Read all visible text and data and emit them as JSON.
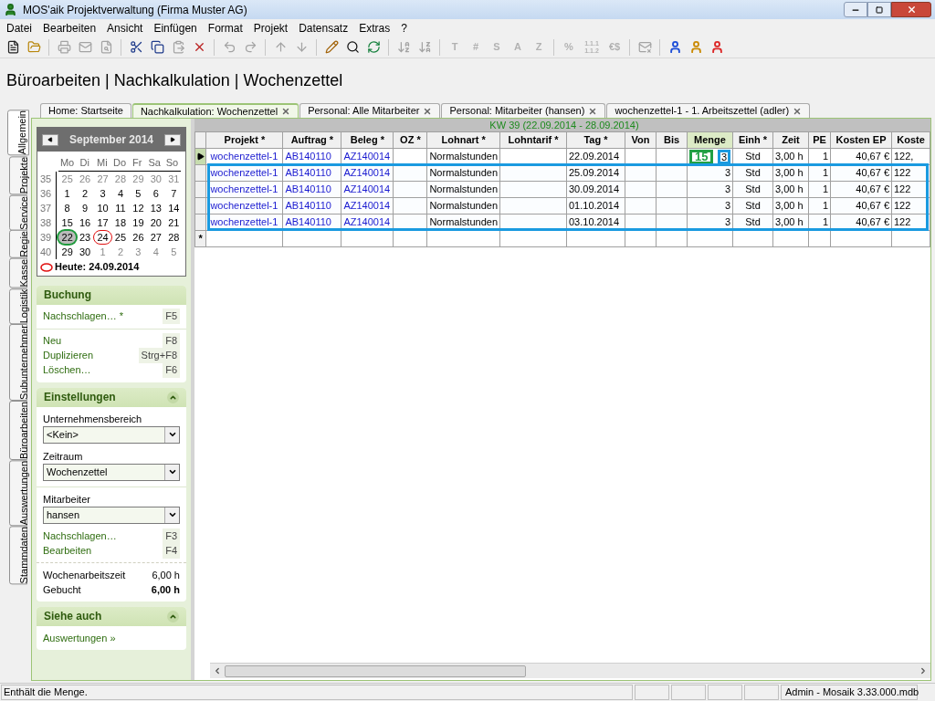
{
  "window": {
    "title": "MOS'aik Projektverwaltung (Firma Muster AG)"
  },
  "menu": [
    "Datei",
    "Bearbeiten",
    "Ansicht",
    "Einfügen",
    "Format",
    "Projekt",
    "Datensatz",
    "Extras",
    "?"
  ],
  "toolbar": [
    {
      "kind": "icon",
      "disabled": false
    },
    {
      "kind": "icon",
      "disabled": false
    },
    {
      "kind": "sep"
    },
    {
      "kind": "icon",
      "disabled": true
    },
    {
      "kind": "icon",
      "disabled": true
    },
    {
      "kind": "icon",
      "disabled": true
    },
    {
      "kind": "sep"
    },
    {
      "kind": "icon",
      "disabled": false
    },
    {
      "kind": "icon",
      "disabled": false
    },
    {
      "kind": "icon",
      "disabled": true
    },
    {
      "kind": "icon",
      "disabled": false
    },
    {
      "kind": "sep"
    },
    {
      "kind": "icon",
      "disabled": true
    },
    {
      "kind": "icon",
      "disabled": true
    },
    {
      "kind": "sep"
    },
    {
      "kind": "icon",
      "disabled": true
    },
    {
      "kind": "icon",
      "disabled": true
    },
    {
      "kind": "sep"
    },
    {
      "kind": "icon",
      "disabled": false
    },
    {
      "kind": "icon",
      "disabled": false
    },
    {
      "kind": "icon",
      "disabled": false
    },
    {
      "kind": "sep"
    },
    {
      "kind": "icon",
      "disabled": true
    },
    {
      "kind": "icon",
      "disabled": true
    },
    {
      "kind": "sep"
    },
    {
      "kind": "glyph",
      "text": "T",
      "disabled": true
    },
    {
      "kind": "glyph",
      "text": "#",
      "disabled": true
    },
    {
      "kind": "glyph",
      "text": "S",
      "disabled": true
    },
    {
      "kind": "glyph",
      "text": "A",
      "disabled": true
    },
    {
      "kind": "glyph",
      "text": "Z",
      "disabled": true
    },
    {
      "kind": "sep"
    },
    {
      "kind": "glyph",
      "text": "%",
      "disabled": true
    },
    {
      "kind": "glyph",
      "text": "1.1.1 1.1.2",
      "disabled": true
    },
    {
      "kind": "glyph",
      "text": "€$",
      "disabled": true
    },
    {
      "kind": "sep"
    },
    {
      "kind": "icon",
      "disabled": true
    },
    {
      "kind": "sep"
    },
    {
      "kind": "icon",
      "disabled": false
    },
    {
      "kind": "icon",
      "disabled": false
    },
    {
      "kind": "icon",
      "disabled": false
    }
  ],
  "page_title": "Büroarbeiten | Nachkalkulation | Wochenzettel",
  "side_tabs": [
    {
      "label": "Allgemein",
      "selected": true
    },
    {
      "label": "Projekte",
      "selected": false
    },
    {
      "label": "Service",
      "selected": false
    },
    {
      "label": "Regie",
      "selected": false
    },
    {
      "label": "Kasse",
      "selected": false
    },
    {
      "label": "Logistik",
      "selected": false
    },
    {
      "label": "Subunternehmer",
      "selected": false
    },
    {
      "label": "Büroarbeiten",
      "selected": false
    },
    {
      "label": "Auswertungen",
      "selected": false
    },
    {
      "label": "Stammdaten",
      "selected": false
    }
  ],
  "doc_tabs": [
    {
      "label": "Home: Startseite",
      "selected": false,
      "closable": false
    },
    {
      "label": "Nachkalkulation: Wochenzettel",
      "selected": true,
      "closable": true
    },
    {
      "label": "Personal: Alle Mitarbeiter",
      "selected": false,
      "closable": true
    },
    {
      "label": "Personal: Mitarbeiter (hansen)",
      "selected": false,
      "closable": true
    },
    {
      "label": "wochenzettel-1 - 1. Arbeitszettel (adler)",
      "selected": false,
      "closable": true
    }
  ],
  "calendar": {
    "month": "September 2014",
    "weekdays": [
      "Mo",
      "Di",
      "Mi",
      "Do",
      "Fr",
      "Sa",
      "So"
    ],
    "weeks": [
      {
        "week": "35",
        "days": [
          {
            "day": "25",
            "muted": true,
            "selected": false,
            "today": false
          },
          {
            "day": "26",
            "muted": true,
            "selected": false,
            "today": false
          },
          {
            "day": "27",
            "muted": true,
            "selected": false,
            "today": false
          },
          {
            "day": "28",
            "muted": true,
            "selected": false,
            "today": false
          },
          {
            "day": "29",
            "muted": true,
            "selected": false,
            "today": false
          },
          {
            "day": "30",
            "muted": true,
            "selected": false,
            "today": false
          },
          {
            "day": "31",
            "muted": true,
            "selected": false,
            "today": false
          }
        ]
      },
      {
        "week": "36",
        "days": [
          {
            "day": "1",
            "muted": false,
            "selected": false,
            "today": false
          },
          {
            "day": "2",
            "muted": false,
            "selected": false,
            "today": false
          },
          {
            "day": "3",
            "muted": false,
            "selected": false,
            "today": false
          },
          {
            "day": "4",
            "muted": false,
            "selected": false,
            "today": false
          },
          {
            "day": "5",
            "muted": false,
            "selected": false,
            "today": false
          },
          {
            "day": "6",
            "muted": false,
            "selected": false,
            "today": false
          },
          {
            "day": "7",
            "muted": false,
            "selected": false,
            "today": false
          }
        ]
      },
      {
        "week": "37",
        "days": [
          {
            "day": "8",
            "muted": false,
            "selected": false,
            "today": false
          },
          {
            "day": "9",
            "muted": false,
            "selected": false,
            "today": false
          },
          {
            "day": "10",
            "muted": false,
            "selected": false,
            "today": false
          },
          {
            "day": "11",
            "muted": false,
            "selected": false,
            "today": false
          },
          {
            "day": "12",
            "muted": false,
            "selected": false,
            "today": false
          },
          {
            "day": "13",
            "muted": false,
            "selected": false,
            "today": false
          },
          {
            "day": "14",
            "muted": false,
            "selected": false,
            "today": false
          }
        ]
      },
      {
        "week": "38",
        "days": [
          {
            "day": "15",
            "muted": false,
            "selected": false,
            "today": false
          },
          {
            "day": "16",
            "muted": false,
            "selected": false,
            "today": false
          },
          {
            "day": "17",
            "muted": false,
            "selected": false,
            "today": false
          },
          {
            "day": "18",
            "muted": false,
            "selected": false,
            "today": false
          },
          {
            "day": "19",
            "muted": false,
            "selected": false,
            "today": false
          },
          {
            "day": "20",
            "muted": false,
            "selected": false,
            "today": false
          },
          {
            "day": "21",
            "muted": false,
            "selected": false,
            "today": false
          }
        ]
      },
      {
        "week": "39",
        "days": [
          {
            "day": "22",
            "muted": false,
            "selected": true,
            "today": false
          },
          {
            "day": "23",
            "muted": false,
            "selected": false,
            "today": false
          },
          {
            "day": "24",
            "muted": false,
            "selected": false,
            "today": true
          },
          {
            "day": "25",
            "muted": false,
            "selected": false,
            "today": false
          },
          {
            "day": "26",
            "muted": false,
            "selected": false,
            "today": false
          },
          {
            "day": "27",
            "muted": false,
            "selected": false,
            "today": false
          },
          {
            "day": "28",
            "muted": false,
            "selected": false,
            "today": false
          }
        ]
      },
      {
        "week": "40",
        "days": [
          {
            "day": "29",
            "muted": false,
            "selected": false,
            "today": false
          },
          {
            "day": "30",
            "muted": false,
            "selected": false,
            "today": false
          },
          {
            "day": "1",
            "muted": true,
            "selected": false,
            "today": false
          },
          {
            "day": "2",
            "muted": true,
            "selected": false,
            "today": false
          },
          {
            "day": "3",
            "muted": true,
            "selected": false,
            "today": false
          },
          {
            "day": "4",
            "muted": true,
            "selected": false,
            "today": false
          },
          {
            "day": "5",
            "muted": true,
            "selected": false,
            "today": false
          }
        ]
      }
    ],
    "today_label": "Heute: 24.09.2014"
  },
  "buchung": {
    "title": "Buchung",
    "groups": [
      [
        {
          "label": "Nachschlagen… *",
          "shortcut": "F5"
        }
      ],
      [
        {
          "label": "Neu",
          "shortcut": "F8"
        },
        {
          "label": "Duplizieren",
          "shortcut": "Strg+F8"
        },
        {
          "label": "Löschen…",
          "shortcut": "F6"
        }
      ]
    ]
  },
  "einstellungen": {
    "title": "Einstellungen",
    "expanded": true,
    "fields": [
      {
        "label": "Unternehmensbereich",
        "value": "<Kein>"
      },
      {
        "label": "Zeitraum",
        "value": "Wochenzettel"
      }
    ],
    "mitarbeiter": {
      "label": "Mitarbeiter",
      "value": "hansen"
    },
    "links": [
      {
        "label": "Nachschlagen…",
        "shortcut": "F3"
      },
      {
        "label": "Bearbeiten",
        "shortcut": "F4"
      }
    ],
    "totals": [
      {
        "label": "Wochenarbeitszeit",
        "value": "6,00 h",
        "bold": false
      },
      {
        "label": "Gebucht",
        "value": "6,00 h",
        "bold": true
      }
    ]
  },
  "siehe_auch": {
    "title": "Siehe auch",
    "expanded": true,
    "links": [
      "Auswertungen »"
    ]
  },
  "grid": {
    "week_label": "KW 39 (22.09.2014 - 28.09.2014)",
    "columns": [
      {
        "label": "Projekt *",
        "selected": false
      },
      {
        "label": "Auftrag *",
        "selected": false
      },
      {
        "label": "Beleg *",
        "selected": false
      },
      {
        "label": "OZ *",
        "selected": false
      },
      {
        "label": "Lohnart *",
        "selected": false
      },
      {
        "label": "Lohntarif *",
        "selected": false
      },
      {
        "label": "Tag *",
        "selected": false
      },
      {
        "label": "Von",
        "selected": false
      },
      {
        "label": "Bis",
        "selected": false
      },
      {
        "label": "Menge",
        "selected": true
      },
      {
        "label": "Einh *",
        "selected": false
      },
      {
        "label": "Zeit",
        "selected": false
      },
      {
        "label": "PE",
        "selected": false
      },
      {
        "label": "Kosten EP",
        "selected": false
      },
      {
        "label": "Koste",
        "selected": false
      }
    ],
    "rows": [
      {
        "current": true,
        "highlighted": false,
        "projekt": "wochenzettel-1",
        "auftrag": "AB140110",
        "beleg": "AZ140014",
        "lohnart": "Normalstunden",
        "tag": "22.09.2014",
        "menge": "3",
        "einh": "Std",
        "zeit": "3,00 h",
        "pe": "1",
        "kosten_ep": "40,67 €",
        "kosten": "122,",
        "note": "15"
      },
      {
        "current": false,
        "highlighted": true,
        "projekt": "wochenzettel-1",
        "auftrag": "AB140110",
        "beleg": "AZ140014",
        "lohnart": "Normalstunden",
        "tag": "25.09.2014",
        "menge": "3",
        "einh": "Std",
        "zeit": "3,00 h",
        "pe": "1",
        "kosten_ep": "40,67 €",
        "kosten": "122"
      },
      {
        "current": false,
        "highlighted": true,
        "projekt": "wochenzettel-1",
        "auftrag": "AB140110",
        "beleg": "AZ140014",
        "lohnart": "Normalstunden",
        "tag": "30.09.2014",
        "menge": "3",
        "einh": "Std",
        "zeit": "3,00 h",
        "pe": "1",
        "kosten_ep": "40,67 €",
        "kosten": "122"
      },
      {
        "current": false,
        "highlighted": true,
        "projekt": "wochenzettel-1",
        "auftrag": "AB140110",
        "beleg": "AZ140014",
        "lohnart": "Normalstunden",
        "tag": "01.10.2014",
        "menge": "3",
        "einh": "Std",
        "zeit": "3,00 h",
        "pe": "1",
        "kosten_ep": "40,67 €",
        "kosten": "122"
      },
      {
        "current": false,
        "highlighted": true,
        "projekt": "wochenzettel-1",
        "auftrag": "AB140110",
        "beleg": "AZ140014",
        "lohnart": "Normalstunden",
        "tag": "03.10.2014",
        "menge": "3",
        "einh": "Std",
        "zeit": "3,00 h",
        "pe": "1",
        "kosten_ep": "40,67 €",
        "kosten": "122"
      }
    ],
    "new_row_marker": "*"
  },
  "status_bar": {
    "message": "Enthält die Menge.",
    "info": "Admin - Mosaik 3.33.000.mdb"
  }
}
